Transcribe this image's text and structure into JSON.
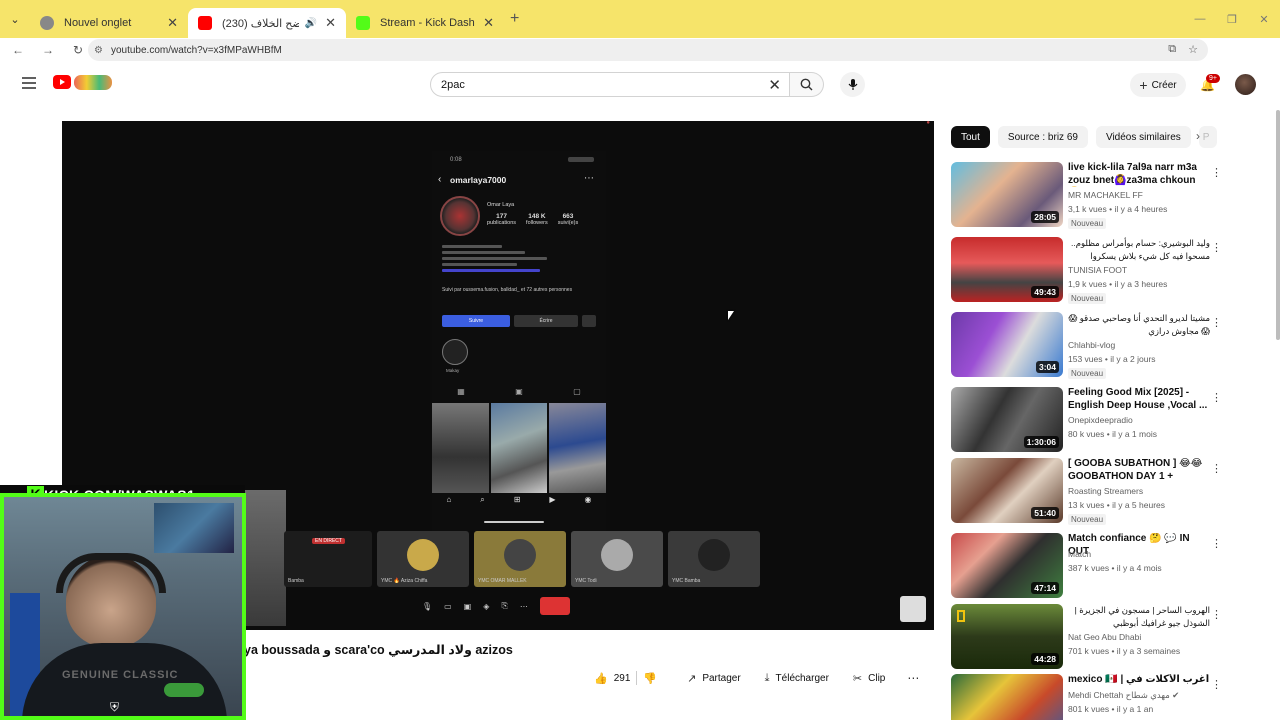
{
  "browser": {
    "tabs": [
      {
        "title": "Nouvel onglet",
        "favicon_color": "#7a7a7a",
        "active": false
      },
      {
        "title": "(230) عربوس يوضح الخلاف",
        "favicon_color": "#ff0000",
        "active": true
      },
      {
        "title": "Stream - Kick Dashboard",
        "favicon_color": "#53fc18",
        "active": false
      }
    ],
    "url": "youtube.com/watch?v=x3fMPaWHBfM"
  },
  "youtube": {
    "search_query": "2pac",
    "create_label": "Créer",
    "notif_badge": "9+",
    "profile_initial": "W"
  },
  "player": {
    "instagram": {
      "clock": "0:08",
      "username": "omarlaya7000",
      "display_name": "Omar Laya",
      "stats": [
        {
          "value": "177",
          "label": "publications"
        },
        {
          "value": "148 K",
          "label": "followers"
        },
        {
          "value": "663",
          "label": "suivi(e)s"
        }
      ],
      "followers_text": "Suivi par oussema.fusion, balldad_ et 72 autres personnes",
      "follow_label": "Suivre",
      "message_label": "Écrire",
      "highlight_label": "Makay"
    },
    "call_badge": "EN DIRECT",
    "tiles": [
      {
        "label": "Bamba"
      },
      {
        "label": "YMC 🔥 Aziza Chiffa"
      },
      {
        "label": "YMC OMAR MALLEK"
      },
      {
        "label": "YMC Todi"
      },
      {
        "label": "YMC Bamba"
      }
    ]
  },
  "video": {
    "title": "ya boussada و scara'co ولاد المدرسي azizos",
    "likes": "291",
    "share_label": "Partager",
    "download_label": "Télécharger",
    "clip_label": "Clip"
  },
  "overlay": {
    "kick_url": "KICK.COM/WASWAS1",
    "kick_logo": "K",
    "shirt_text": "GENUINE CLASSIC"
  },
  "sidebar": {
    "chips": [
      {
        "label": "Tout",
        "active": true
      },
      {
        "label": "Source : briz 69",
        "active": false
      },
      {
        "label": "Vidéos similaires",
        "active": false
      },
      {
        "label": "P",
        "active": false
      }
    ],
    "items": [
      {
        "title": "live kick-lila 7al9a narr m3a zouz bnet🙆‍♀️za3ma chkoun😬...",
        "channel": "MR MACHAKEL FF",
        "meta": "3,1 k vues • il y a 4 heures",
        "badge": "Nouveau",
        "duration": "28:05",
        "rtl": false
      },
      {
        "title": "وليد البوشيري: حسام بوأمراس مظلوم.. مسحوا فيه كل شيء بلاش يسكروا الناس",
        "channel": "TUNISIA FOOT",
        "meta": "1,9 k vues • il y a 3 heures",
        "badge": "Nouveau",
        "duration": "49:43",
        "rtl": true
      },
      {
        "title": "مشيتا لديرو التحدي أنا وصاحبي صدقو 😱😱 مجاوش درازي",
        "channel": "Chlahbi-vlog",
        "meta": "153 vues • il y a 2 jours",
        "badge": "Nouveau",
        "duration": "3:04",
        "rtl": true
      },
      {
        "title": "Feeling Good Mix [2025] - English Deep House ,Vocal ...",
        "channel": "Onepixdeepradio",
        "meta": "80 k vues • il y a 1 mois",
        "badge": "",
        "duration": "1:30:06",
        "rtl": false
      },
      {
        "title": "[ GOOBA SUBATHON ] 😂😂 GOOBATHON DAY 1 + DAKHL...",
        "channel": "Roasting Streamers",
        "meta": "13 k vues • il y a 5 heures",
        "badge": "Nouveau",
        "duration": "51:40",
        "rtl": false
      },
      {
        "title": "Match confiance 🤔 💬 IN OUT",
        "channel": "Match",
        "meta": "387 k vues • il y a 4 mois",
        "badge": "",
        "duration": "47:14",
        "rtl": false
      },
      {
        "title": "الهروب الساحر | مسجون في الجزيرة | الشوذل جيو غرافيك أبوظبي",
        "channel": "Nat Geo Abu Dhabi",
        "meta": "701 k vues • il y a 3 semaines",
        "badge": "",
        "duration": "44:28",
        "rtl": true
      },
      {
        "title": "mexico 🇲🇽 | أغرب الأكلات في المكسيك",
        "channel": "Mehdi Chettah مهدي شطاح ✔",
        "meta": "801 k vues • il y a 1 an",
        "badge": "",
        "duration": "",
        "rtl": false
      }
    ]
  }
}
